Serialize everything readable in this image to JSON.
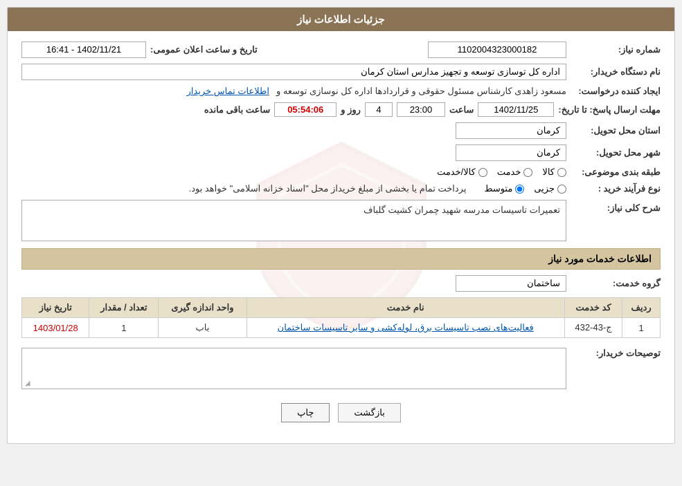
{
  "header": {
    "title": "جزئیات اطلاعات نیاز"
  },
  "fields": {
    "need_number_label": "شماره نیاز:",
    "need_number_value": "1102004323000182",
    "buyer_org_label": "نام دستگاه خریدار:",
    "buyer_org_value": "اداره کل توسازی  توسعه و تجهیز مدارس استان کرمان",
    "creator_label": "ایجاد کننده درخواست:",
    "creator_value": "مسعود زاهدی کارشناس مسئول حقوقی و قراردادها اداره کل نوسازی  توسعه و",
    "creator_contact": "اطلاعات تماس خریدار",
    "send_date_label": "مهلت ارسال پاسخ: تا تاریخ:",
    "send_date_value": "1402/11/25",
    "send_time_label": "ساعت",
    "send_time_value": "23:00",
    "send_days_label": "روز و",
    "send_days_value": "4",
    "send_remaining_label": "ساعت باقی مانده",
    "send_remaining_value": "05:54:06",
    "province_label": "استان محل تحویل:",
    "province_value": "کرمان",
    "city_label": "شهر محل تحویل:",
    "city_value": "کرمان",
    "category_label": "طبقه بندی موضوعی:",
    "category_kala": "کالا",
    "category_khedmat": "خدمت",
    "category_kala_khedmat": "کالا/خدمت",
    "purchase_type_label": "نوع فرآیند خرید :",
    "purchase_jozei": "جزیی",
    "purchase_mottavasset": "متوسط",
    "purchase_note": "پرداخت تمام یا بخشی از مبلغ خریداز محل \"اسناد خزانه اسلامی\" خواهد بود.",
    "description_label": "شرح کلی نیاز:",
    "description_value": "تعمیرات تاسیسات مدرسه شهید چمران کشیت گلباف",
    "services_section_label": "اطلاعات خدمات مورد نیاز",
    "service_group_label": "گروه خدمت:",
    "service_group_value": "ساختمان",
    "table": {
      "col_row": "ردیف",
      "col_code": "کد خدمت",
      "col_name": "نام خدمت",
      "col_unit": "واحد اندازه گیری",
      "col_qty": "تعداد / مقدار",
      "col_date": "تاریخ نیاز",
      "rows": [
        {
          "row": "1",
          "code": "ج-43-432",
          "name": "فعالیت‌های نصب تاسیسات برق، لوله‌کشی و سایر تاسیسات ساختمان",
          "unit": "باب",
          "qty": "1",
          "date": "1403/01/28"
        }
      ]
    },
    "buyer_desc_label": "توصیحات خریدار:"
  },
  "buttons": {
    "print": "چاپ",
    "back": "بازگشت"
  }
}
